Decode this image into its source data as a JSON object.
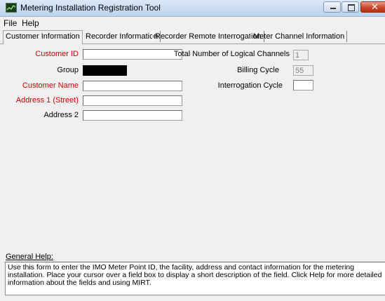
{
  "window": {
    "title": "Metering Installation Registration Tool",
    "close_glyph": "✕"
  },
  "menu": {
    "file": "File",
    "help": "Help"
  },
  "tabs": [
    {
      "label": "Customer Information",
      "active": true
    },
    {
      "label": "Recorder Information",
      "active": false
    },
    {
      "label": "Recorder Remote Interrogation",
      "active": false
    },
    {
      "label": "Meter Channel Information",
      "active": false
    }
  ],
  "form": {
    "customer_id": {
      "label": "Customer ID",
      "value": ""
    },
    "group": {
      "label": "Group",
      "value": ""
    },
    "customer_name": {
      "label": "Customer Name",
      "value": ""
    },
    "address1": {
      "label": "Address 1 (Street)",
      "value": ""
    },
    "address2": {
      "label": "Address 2",
      "value": ""
    },
    "total_channels": {
      "label": "Total Number of Logical Channels",
      "value": "1"
    },
    "billing_cycle": {
      "label": "Billing Cycle",
      "value": "55"
    },
    "interrogation_cycle": {
      "label": "Interrogation Cycle",
      "value": ""
    }
  },
  "general_help": {
    "label": "General Help:",
    "text": "Use this form to enter the IMO Meter Point ID, the facility, address and contact information for the metering installation.  Place your cursor over a field box to display a short description of the field. Click Help for more detailed information about the fields and using MIRT."
  },
  "colors": {
    "required_label": "#cc0000",
    "group_field": "#000000"
  }
}
